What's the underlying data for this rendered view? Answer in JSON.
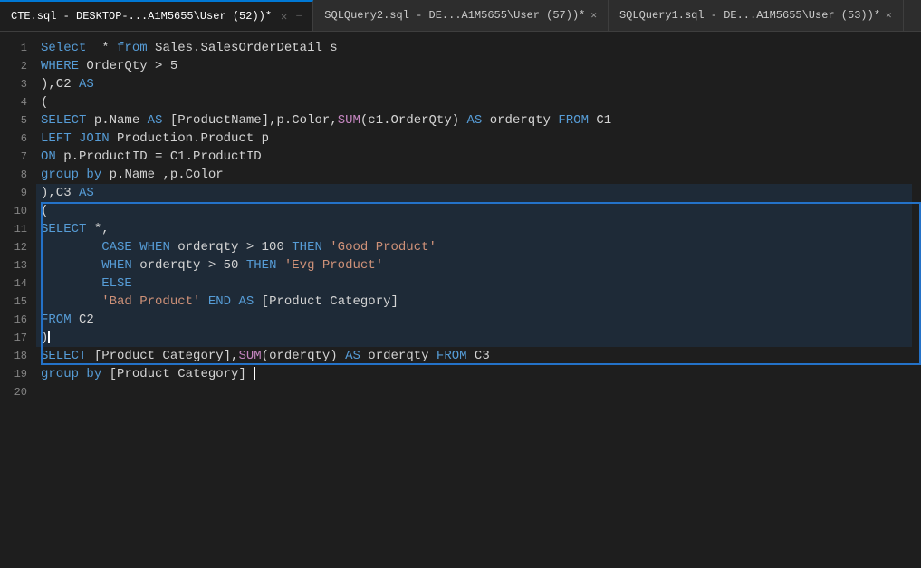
{
  "tabs": [
    {
      "id": "tab1",
      "label": "CTE.sql - DESKTOP-...A1M5655\\User (52))*",
      "active": true,
      "pinned": false
    },
    {
      "id": "tab2",
      "label": "SQLQuery2.sql - DE...A1M5655\\User (57))*",
      "active": false,
      "pinned": false
    },
    {
      "id": "tab3",
      "label": "SQLQuery1.sql - DE...A1M5655\\User (53))*",
      "active": false,
      "pinned": false
    }
  ],
  "lines": [
    {
      "num": "",
      "content": ""
    },
    {
      "num": "1",
      "tokens": [
        {
          "t": "kw",
          "v": "Select"
        },
        {
          "t": "plain",
          "v": "  * "
        },
        {
          "t": "kw",
          "v": "from"
        },
        {
          "t": "plain",
          "v": " Sales.SalesOrderDetail s"
        }
      ]
    },
    {
      "num": "2",
      "tokens": [
        {
          "t": "kw",
          "v": "WHERE"
        },
        {
          "t": "plain",
          "v": " OrderQty > 5"
        }
      ]
    },
    {
      "num": "3",
      "tokens": [
        {
          "t": "plain",
          "v": "),C2 "
        },
        {
          "t": "kw",
          "v": "AS"
        }
      ]
    },
    {
      "num": "4",
      "tokens": [
        {
          "t": "plain",
          "v": "("
        }
      ]
    },
    {
      "num": "5",
      "tokens": [
        {
          "t": "kw",
          "v": "SELECT"
        },
        {
          "t": "plain",
          "v": " p.Name "
        },
        {
          "t": "kw",
          "v": "AS"
        },
        {
          "t": "plain",
          "v": " [ProductName],p.Color,"
        },
        {
          "t": "kw2",
          "v": "SUM"
        },
        {
          "t": "plain",
          "v": "(c1.OrderQty) "
        },
        {
          "t": "kw",
          "v": "AS"
        },
        {
          "t": "plain",
          "v": " orderqty "
        },
        {
          "t": "kw",
          "v": "FROM"
        },
        {
          "t": "plain",
          "v": " C1"
        }
      ]
    },
    {
      "num": "6",
      "tokens": [
        {
          "t": "kw",
          "v": "LEFT"
        },
        {
          "t": "plain",
          "v": " "
        },
        {
          "t": "kw",
          "v": "JOIN"
        },
        {
          "t": "plain",
          "v": " Production.Product p"
        }
      ]
    },
    {
      "num": "7",
      "tokens": [
        {
          "t": "kw",
          "v": "ON"
        },
        {
          "t": "plain",
          "v": " p.ProductID = C1.ProductID"
        }
      ]
    },
    {
      "num": "8",
      "tokens": [
        {
          "t": "kw",
          "v": "group"
        },
        {
          "t": "plain",
          "v": " "
        },
        {
          "t": "kw",
          "v": "by"
        },
        {
          "t": "plain",
          "v": " p.Name ,p.Color"
        }
      ]
    },
    {
      "num": "9",
      "selected": true,
      "tokens": [
        {
          "t": "plain",
          "v": "),C3 "
        },
        {
          "t": "kw",
          "v": "AS"
        }
      ]
    },
    {
      "num": "10",
      "selected": true,
      "tokens": [
        {
          "t": "plain",
          "v": "("
        }
      ]
    },
    {
      "num": "11",
      "selected": true,
      "tokens": [
        {
          "t": "kw",
          "v": "SELECT"
        },
        {
          "t": "plain",
          "v": " *,"
        }
      ]
    },
    {
      "num": "12",
      "selected": true,
      "tokens": [
        {
          "t": "plain",
          "v": "        "
        },
        {
          "t": "kw",
          "v": "CASE"
        },
        {
          "t": "plain",
          "v": " "
        },
        {
          "t": "kw",
          "v": "WHEN"
        },
        {
          "t": "plain",
          "v": " orderqty > 100 "
        },
        {
          "t": "kw",
          "v": "THEN"
        },
        {
          "t": "plain",
          "v": " "
        },
        {
          "t": "txt",
          "v": "'Good Product'"
        }
      ]
    },
    {
      "num": "13",
      "selected": true,
      "tokens": [
        {
          "t": "plain",
          "v": "        "
        },
        {
          "t": "kw",
          "v": "WHEN"
        },
        {
          "t": "plain",
          "v": " orderqty > 50 "
        },
        {
          "t": "kw",
          "v": "THEN"
        },
        {
          "t": "plain",
          "v": " "
        },
        {
          "t": "txt",
          "v": "'Evg Product'"
        }
      ]
    },
    {
      "num": "14",
      "selected": true,
      "tokens": [
        {
          "t": "plain",
          "v": "        "
        },
        {
          "t": "kw",
          "v": "ELSE"
        }
      ]
    },
    {
      "num": "15",
      "selected": true,
      "tokens": [
        {
          "t": "plain",
          "v": "        "
        },
        {
          "t": "txt",
          "v": "'Bad Product'"
        },
        {
          "t": "plain",
          "v": " "
        },
        {
          "t": "kw",
          "v": "END"
        },
        {
          "t": "plain",
          "v": " "
        },
        {
          "t": "kw",
          "v": "AS"
        },
        {
          "t": "plain",
          "v": " [Product Category]"
        }
      ]
    },
    {
      "num": "16",
      "selected": true,
      "tokens": [
        {
          "t": "kw",
          "v": "FROM"
        },
        {
          "t": "plain",
          "v": " C2"
        }
      ]
    },
    {
      "num": "17",
      "selected": true,
      "tokens": [
        {
          "t": "plain",
          "v": ")"
        },
        {
          "t": "cursor",
          "v": ""
        }
      ]
    },
    {
      "num": "18",
      "tokens": [
        {
          "t": "kw",
          "v": "SELECT"
        },
        {
          "t": "plain",
          "v": " [Product Category],"
        },
        {
          "t": "kw2",
          "v": "SUM"
        },
        {
          "t": "plain",
          "v": "(orderqty) "
        },
        {
          "t": "kw",
          "v": "AS"
        },
        {
          "t": "plain",
          "v": " orderqty "
        },
        {
          "t": "kw",
          "v": "FROM"
        },
        {
          "t": "plain",
          "v": " C3"
        }
      ]
    },
    {
      "num": "19",
      "tokens": [
        {
          "t": "kw",
          "v": "group"
        },
        {
          "t": "plain",
          "v": " "
        },
        {
          "t": "kw",
          "v": "by"
        },
        {
          "t": "plain",
          "v": " [Product Category] "
        },
        {
          "t": "cursor2",
          "v": ""
        }
      ]
    },
    {
      "num": "20",
      "tokens": []
    }
  ],
  "colors": {
    "tab_active_border": "#0078d4",
    "selection_border": "#2472c8",
    "background": "#1e1e1e"
  }
}
